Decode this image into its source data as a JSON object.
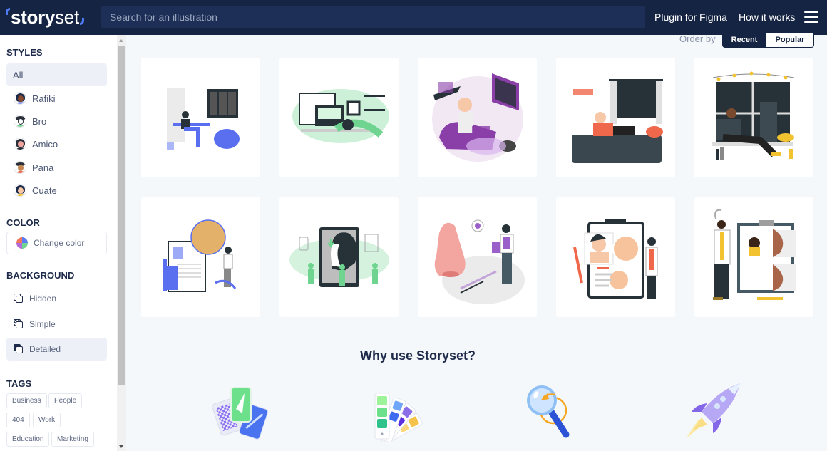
{
  "header": {
    "logo_bold": "story",
    "logo_light": "set",
    "search_placeholder": "Search for an illustration",
    "search_value": "",
    "nav": [
      "Plugin for Figma",
      "How it works"
    ],
    "menu_icon": "hamburger-menu-icon"
  },
  "sidebar": {
    "styles_title": "STYLES",
    "styles": [
      {
        "label": "All",
        "active": true
      },
      {
        "label": "Rafiki",
        "icon": "rafiki-avatar-icon"
      },
      {
        "label": "Bro",
        "icon": "bro-avatar-icon"
      },
      {
        "label": "Amico",
        "icon": "amico-avatar-icon"
      },
      {
        "label": "Pana",
        "icon": "pana-avatar-icon"
      },
      {
        "label": "Cuate",
        "icon": "cuate-avatar-icon"
      }
    ],
    "color_title": "COLOR",
    "change_color_label": "Change color",
    "background_title": "BACKGROUND",
    "backgrounds": [
      {
        "label": "Hidden",
        "active": false
      },
      {
        "label": "Simple",
        "active": false
      },
      {
        "label": "Detailed",
        "active": true
      }
    ],
    "tags_title": "TAGS",
    "tags": [
      "Business",
      "People",
      "404",
      "Work",
      "Education",
      "Marketing"
    ]
  },
  "order": {
    "label": "Order by",
    "options": [
      "Recent",
      "Popular"
    ],
    "selected": "Recent"
  },
  "illustrations": [
    {
      "name": "working-at-home-illustration",
      "accent": "#5a6ff0"
    },
    {
      "name": "sleeping-at-desk-illustration",
      "accent": "#6fd48f"
    },
    {
      "name": "listening-music-illustration",
      "accent": "#8a3fa8"
    },
    {
      "name": "night-reading-illustration",
      "accent": "#f0684c"
    },
    {
      "name": "window-laptop-illustration",
      "accent": "#f2c230"
    },
    {
      "name": "nose-surgery-chart-illustration",
      "accent": "#5a6ff0"
    },
    {
      "name": "face-profile-surgery-illustration",
      "accent": "#6fd48f"
    },
    {
      "name": "nose-doctor-illustration",
      "accent": "#9b5fc9"
    },
    {
      "name": "clipboard-nose-illustration",
      "accent": "#f0684c"
    },
    {
      "name": "before-after-nose-illustration",
      "accent": "#f2c230"
    }
  ],
  "why": {
    "title": "Why use Storyset?",
    "features": [
      "cards-feature-icon",
      "color-palette-feature-icon",
      "magnifier-feature-icon",
      "rocket-feature-icon"
    ]
  }
}
